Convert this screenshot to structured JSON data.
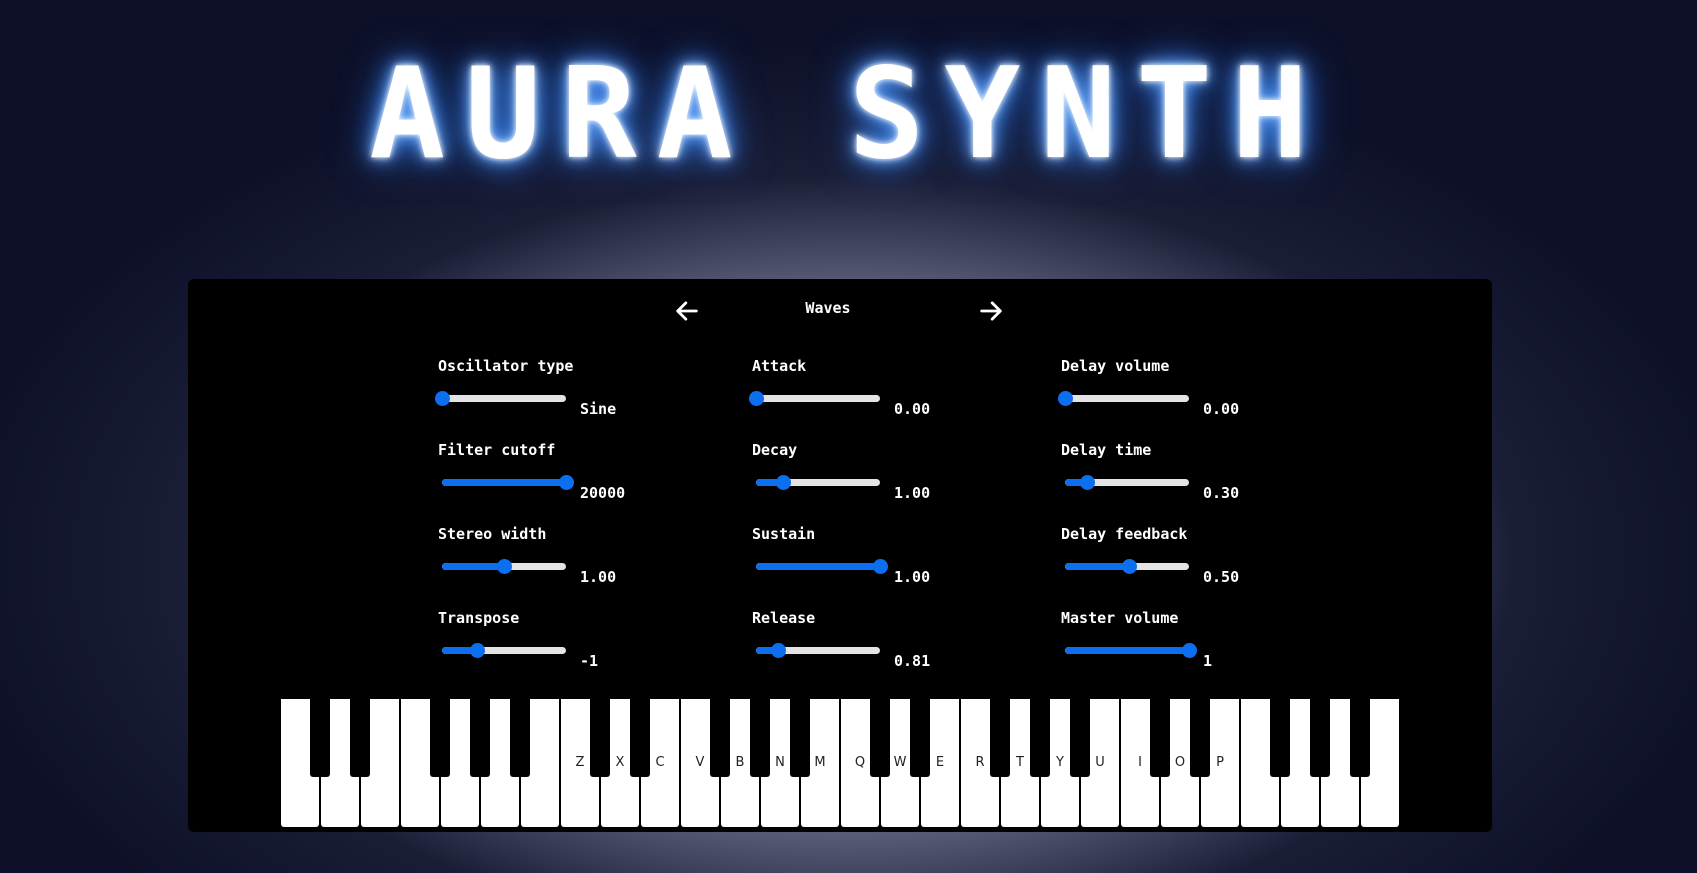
{
  "app": {
    "title": "AURA SYNTH"
  },
  "panel": {
    "title": "Waves",
    "prev_icon": "arrow-left-icon",
    "next_icon": "arrow-right-icon",
    "accent_color": "#0b6ff0",
    "controls": [
      {
        "label": "Oscillator type",
        "value": "Sine",
        "level": 0.0
      },
      {
        "label": "Filter cutoff",
        "value": "20000",
        "level": 1.0
      },
      {
        "label": "Stereo width",
        "value": "1.00",
        "level": 0.5
      },
      {
        "label": "Transpose",
        "value": "-1",
        "level": 0.28
      },
      {
        "label": "Attack",
        "value": "0.00",
        "level": 0.0
      },
      {
        "label": "Decay",
        "value": "1.00",
        "level": 0.22
      },
      {
        "label": "Sustain",
        "value": "1.00",
        "level": 1.0
      },
      {
        "label": "Release",
        "value": "0.81",
        "level": 0.18
      },
      {
        "label": "Delay volume",
        "value": "0.00",
        "level": 0.0
      },
      {
        "label": "Delay time",
        "value": "0.30",
        "level": 0.18
      },
      {
        "label": "Delay feedback",
        "value": "0.50",
        "level": 0.52
      },
      {
        "label": "Master volume",
        "value": "1",
        "level": 1.0
      }
    ]
  },
  "keyboard": {
    "white_keys": [
      "",
      "",
      "",
      "",
      "",
      "",
      "",
      "Z",
      "X",
      "C",
      "V",
      "B",
      "N",
      "M",
      "Q",
      "W",
      "E",
      "R",
      "T",
      "Y",
      "U",
      "I",
      "O",
      "P",
      "",
      "",
      "",
      ""
    ],
    "black_key_count": 20
  }
}
